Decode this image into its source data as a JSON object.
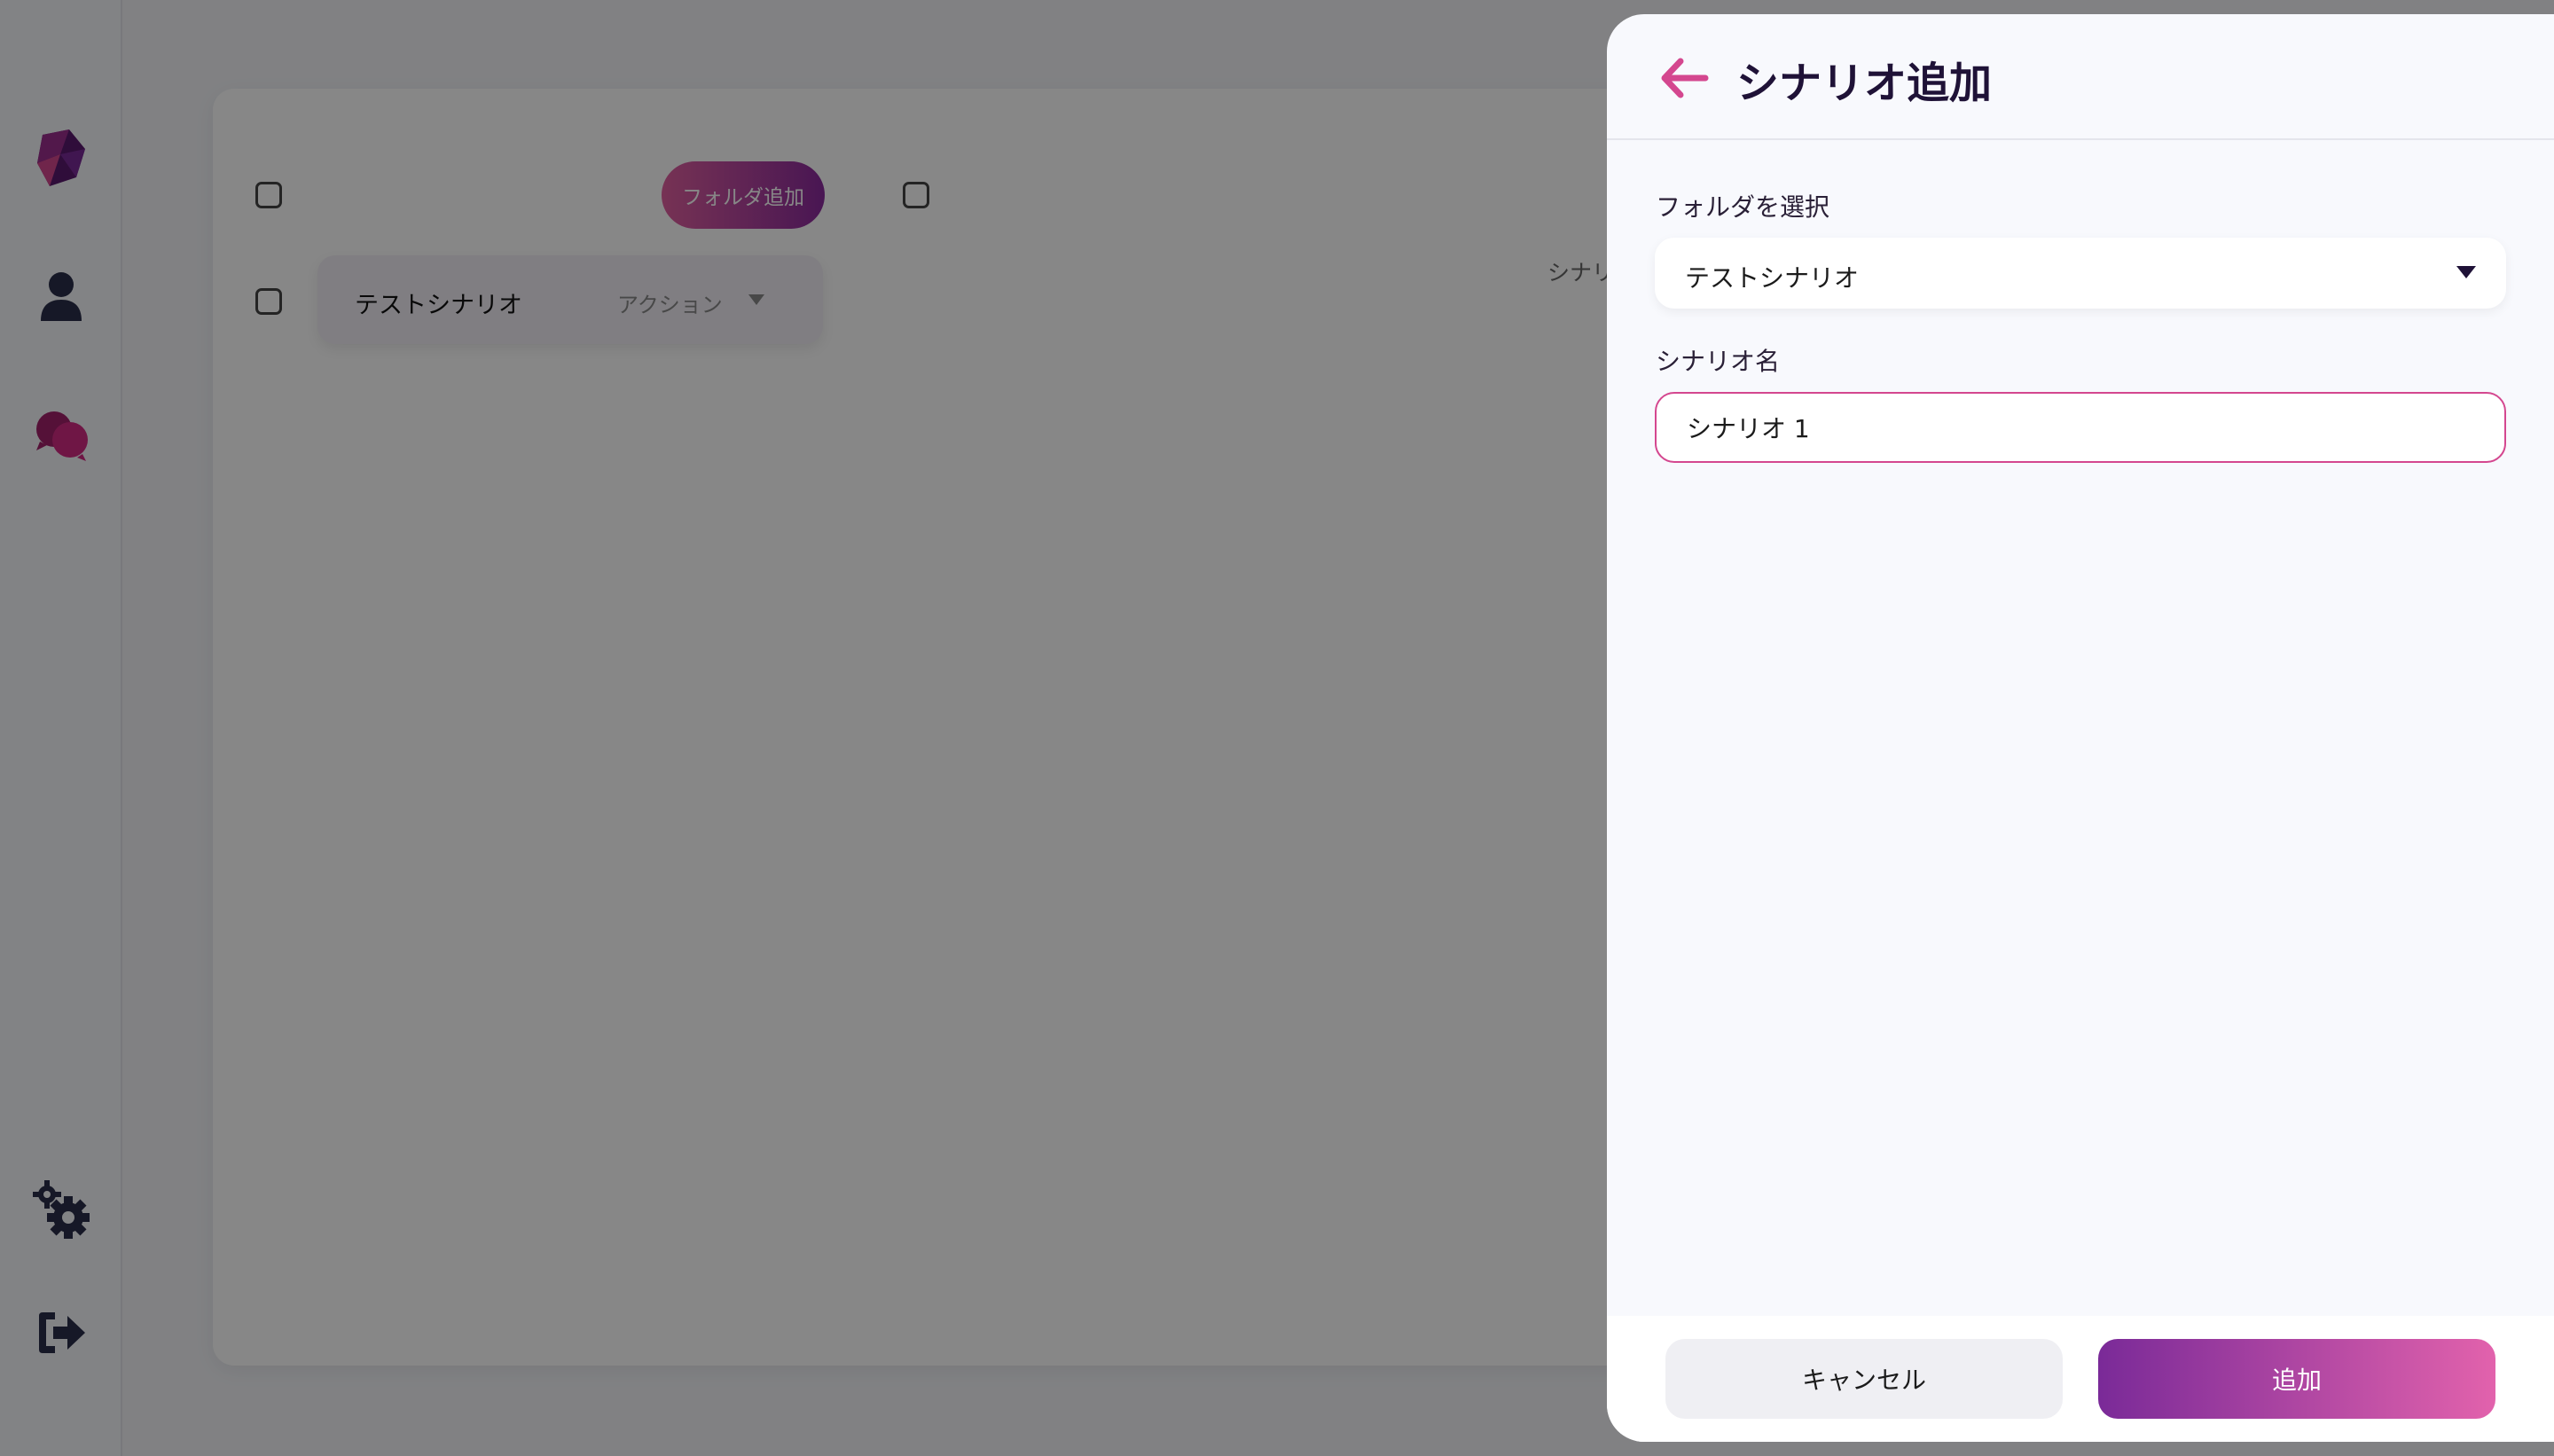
{
  "sidebar": {
    "icons": [
      {
        "name": "app-logo-icon"
      },
      {
        "name": "user-icon"
      },
      {
        "name": "chat-bubbles-icon"
      },
      {
        "name": "gears-icon"
      },
      {
        "name": "logout-icon"
      }
    ]
  },
  "main": {
    "folder_add_label": "フォルダ追加",
    "folder_row": {
      "name": "テストシナリオ",
      "action_label": "アクション"
    },
    "partial_scenario_text": "シナリ"
  },
  "panel": {
    "title": "シナリオ追加",
    "folder_label": "フォルダを選択",
    "folder_value": "テストシナリオ",
    "scenario_label": "シナリオ名",
    "scenario_value": "シナリオ 1",
    "cancel_label": "キャンセル",
    "add_label": "追加"
  },
  "colors": {
    "accent_pink": "#d4478f",
    "accent_purple": "#7a2a98",
    "title_dark": "#1f1237"
  }
}
